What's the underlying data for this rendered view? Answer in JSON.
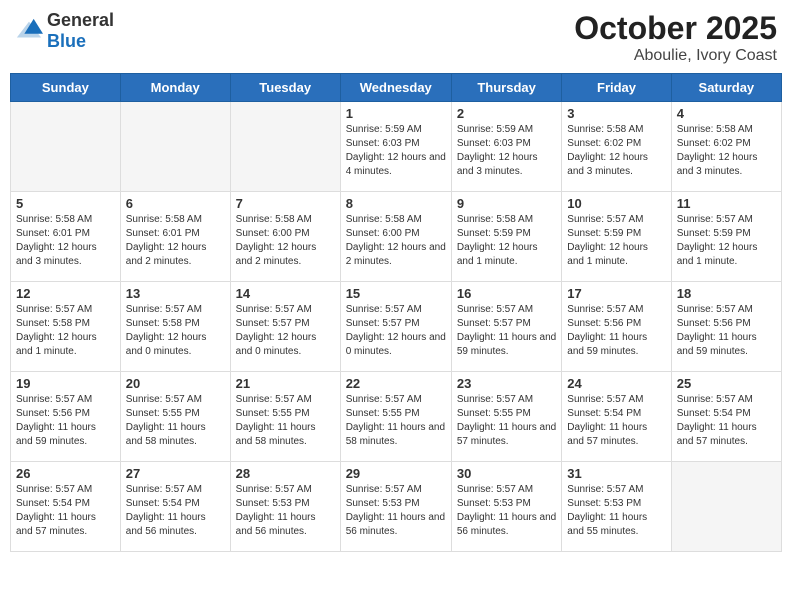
{
  "header": {
    "logo_general": "General",
    "logo_blue": "Blue",
    "title": "October 2025",
    "subtitle": "Aboulie, Ivory Coast"
  },
  "days_of_week": [
    "Sunday",
    "Monday",
    "Tuesday",
    "Wednesday",
    "Thursday",
    "Friday",
    "Saturday"
  ],
  "weeks": [
    [
      {
        "day": "",
        "info": ""
      },
      {
        "day": "",
        "info": ""
      },
      {
        "day": "",
        "info": ""
      },
      {
        "day": "1",
        "info": "Sunrise: 5:59 AM\nSunset: 6:03 PM\nDaylight: 12 hours and 4 minutes."
      },
      {
        "day": "2",
        "info": "Sunrise: 5:59 AM\nSunset: 6:03 PM\nDaylight: 12 hours and 3 minutes."
      },
      {
        "day": "3",
        "info": "Sunrise: 5:58 AM\nSunset: 6:02 PM\nDaylight: 12 hours and 3 minutes."
      },
      {
        "day": "4",
        "info": "Sunrise: 5:58 AM\nSunset: 6:02 PM\nDaylight: 12 hours and 3 minutes."
      }
    ],
    [
      {
        "day": "5",
        "info": "Sunrise: 5:58 AM\nSunset: 6:01 PM\nDaylight: 12 hours and 3 minutes."
      },
      {
        "day": "6",
        "info": "Sunrise: 5:58 AM\nSunset: 6:01 PM\nDaylight: 12 hours and 2 minutes."
      },
      {
        "day": "7",
        "info": "Sunrise: 5:58 AM\nSunset: 6:00 PM\nDaylight: 12 hours and 2 minutes."
      },
      {
        "day": "8",
        "info": "Sunrise: 5:58 AM\nSunset: 6:00 PM\nDaylight: 12 hours and 2 minutes."
      },
      {
        "day": "9",
        "info": "Sunrise: 5:58 AM\nSunset: 5:59 PM\nDaylight: 12 hours and 1 minute."
      },
      {
        "day": "10",
        "info": "Sunrise: 5:57 AM\nSunset: 5:59 PM\nDaylight: 12 hours and 1 minute."
      },
      {
        "day": "11",
        "info": "Sunrise: 5:57 AM\nSunset: 5:59 PM\nDaylight: 12 hours and 1 minute."
      }
    ],
    [
      {
        "day": "12",
        "info": "Sunrise: 5:57 AM\nSunset: 5:58 PM\nDaylight: 12 hours and 1 minute."
      },
      {
        "day": "13",
        "info": "Sunrise: 5:57 AM\nSunset: 5:58 PM\nDaylight: 12 hours and 0 minutes."
      },
      {
        "day": "14",
        "info": "Sunrise: 5:57 AM\nSunset: 5:57 PM\nDaylight: 12 hours and 0 minutes."
      },
      {
        "day": "15",
        "info": "Sunrise: 5:57 AM\nSunset: 5:57 PM\nDaylight: 12 hours and 0 minutes."
      },
      {
        "day": "16",
        "info": "Sunrise: 5:57 AM\nSunset: 5:57 PM\nDaylight: 11 hours and 59 minutes."
      },
      {
        "day": "17",
        "info": "Sunrise: 5:57 AM\nSunset: 5:56 PM\nDaylight: 11 hours and 59 minutes."
      },
      {
        "day": "18",
        "info": "Sunrise: 5:57 AM\nSunset: 5:56 PM\nDaylight: 11 hours and 59 minutes."
      }
    ],
    [
      {
        "day": "19",
        "info": "Sunrise: 5:57 AM\nSunset: 5:56 PM\nDaylight: 11 hours and 59 minutes."
      },
      {
        "day": "20",
        "info": "Sunrise: 5:57 AM\nSunset: 5:55 PM\nDaylight: 11 hours and 58 minutes."
      },
      {
        "day": "21",
        "info": "Sunrise: 5:57 AM\nSunset: 5:55 PM\nDaylight: 11 hours and 58 minutes."
      },
      {
        "day": "22",
        "info": "Sunrise: 5:57 AM\nSunset: 5:55 PM\nDaylight: 11 hours and 58 minutes."
      },
      {
        "day": "23",
        "info": "Sunrise: 5:57 AM\nSunset: 5:55 PM\nDaylight: 11 hours and 57 minutes."
      },
      {
        "day": "24",
        "info": "Sunrise: 5:57 AM\nSunset: 5:54 PM\nDaylight: 11 hours and 57 minutes."
      },
      {
        "day": "25",
        "info": "Sunrise: 5:57 AM\nSunset: 5:54 PM\nDaylight: 11 hours and 57 minutes."
      }
    ],
    [
      {
        "day": "26",
        "info": "Sunrise: 5:57 AM\nSunset: 5:54 PM\nDaylight: 11 hours and 57 minutes."
      },
      {
        "day": "27",
        "info": "Sunrise: 5:57 AM\nSunset: 5:54 PM\nDaylight: 11 hours and 56 minutes."
      },
      {
        "day": "28",
        "info": "Sunrise: 5:57 AM\nSunset: 5:53 PM\nDaylight: 11 hours and 56 minutes."
      },
      {
        "day": "29",
        "info": "Sunrise: 5:57 AM\nSunset: 5:53 PM\nDaylight: 11 hours and 56 minutes."
      },
      {
        "day": "30",
        "info": "Sunrise: 5:57 AM\nSunset: 5:53 PM\nDaylight: 11 hours and 56 minutes."
      },
      {
        "day": "31",
        "info": "Sunrise: 5:57 AM\nSunset: 5:53 PM\nDaylight: 11 hours and 55 minutes."
      },
      {
        "day": "",
        "info": ""
      }
    ]
  ]
}
